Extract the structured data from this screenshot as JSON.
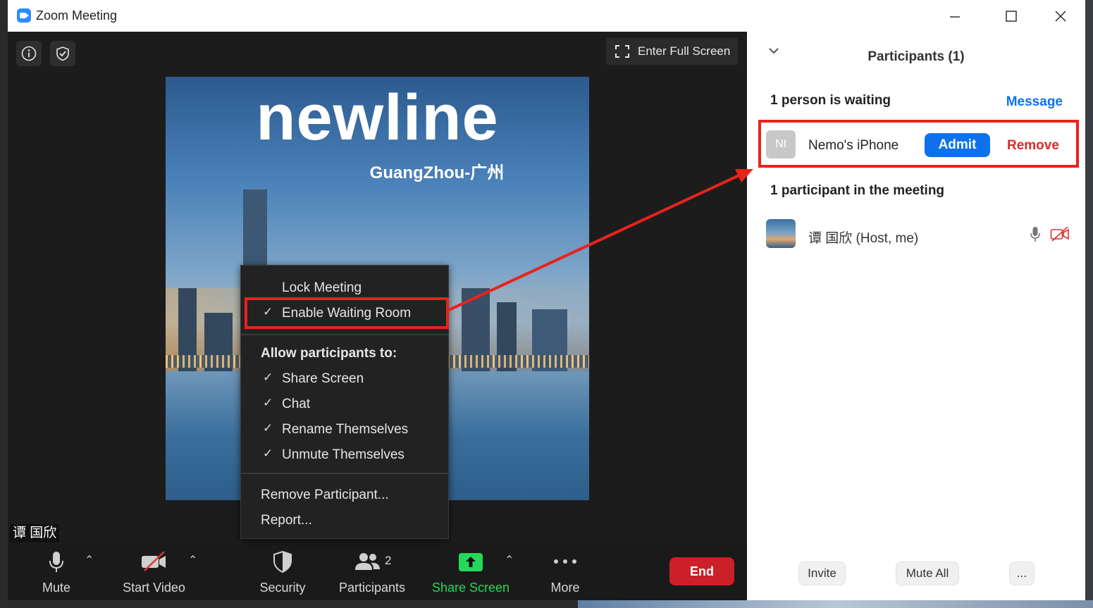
{
  "window": {
    "title": "Zoom Meeting"
  },
  "stage": {
    "fullscreen_label": "Enter Full Screen",
    "video_logo": "newline",
    "video_subtitle": "GuangZhou-广州",
    "name_tag": "谭 国欣"
  },
  "security_menu": {
    "lock_meeting": "Lock Meeting",
    "enable_waiting_room": "Enable Waiting Room",
    "allow_heading": "Allow participants to:",
    "share_screen": "Share Screen",
    "chat": "Chat",
    "rename": "Rename Themselves",
    "unmute": "Unmute Themselves",
    "remove_participant": "Remove Participant...",
    "report": "Report...",
    "check_glyph": "✓"
  },
  "toolbar": {
    "mute": "Mute",
    "start_video": "Start Video",
    "security": "Security",
    "participants": "Participants",
    "participants_count": "2",
    "share_screen": "Share Screen",
    "more": "More",
    "end": "End"
  },
  "panel": {
    "title": "Participants (1)",
    "waiting_heading": "1 person is waiting",
    "message": "Message",
    "waiting_initials": "NI",
    "waiting_name": "Nemo's iPhone",
    "admit": "Admit",
    "remove": "Remove",
    "in_meeting_heading": "1 participant in the meeting",
    "me_name": "谭 国欣 (Host, me)",
    "invite": "Invite",
    "mute_all": "Mute All",
    "more": "..."
  },
  "colors": {
    "accent_blue": "#0e71eb",
    "share_green": "#23d959",
    "end_red": "#cb2027",
    "highlight_red": "#e8231c"
  }
}
